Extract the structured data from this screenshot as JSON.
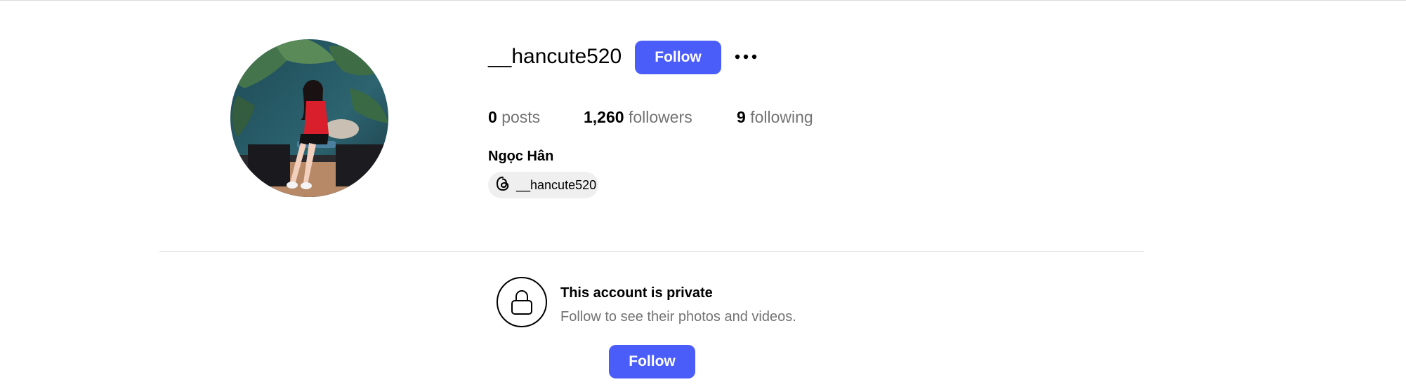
{
  "profile": {
    "username": "__hancute520",
    "follow_label": "Follow",
    "more_icon": "more-options-icon",
    "full_name": "Ngọc Hân",
    "threads_handle": "__hancute520",
    "threads_icon": "threads-icon"
  },
  "stats": {
    "posts": {
      "count": "0",
      "label": "posts"
    },
    "followers": {
      "count": "1,260",
      "label": "followers"
    },
    "following": {
      "count": "9",
      "label": "following"
    }
  },
  "private_notice": {
    "icon": "lock-icon",
    "title": "This account is private",
    "subtitle": "Follow to see their photos and videos.",
    "follow_label": "Follow"
  },
  "colors": {
    "accent": "#4a5df9",
    "muted_text": "#737373",
    "divider": "#dbdbdb",
    "badge_bg": "#efefef"
  }
}
